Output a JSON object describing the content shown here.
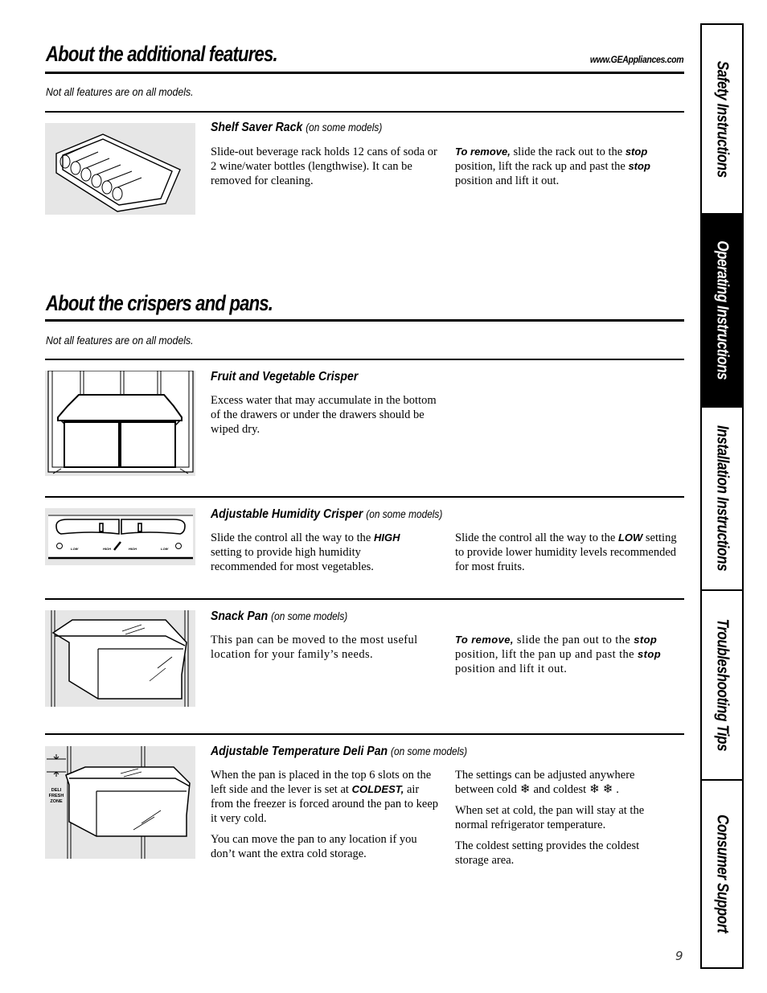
{
  "header": {
    "url": "www.GEAppliances.com"
  },
  "sections": [
    {
      "title": "About the additional features.",
      "note": "Not all features are on all models."
    },
    {
      "title": "About the crispers and pans.",
      "note": "Not all features are on all models."
    }
  ],
  "features": {
    "shelf_saver": {
      "title": "Shelf Saver Rack",
      "subtitle": "(on some models)",
      "col1": "Slide-out beverage rack holds 12 cans of soda or 2 wine/water bottles (lengthwise). It can be removed for cleaning.",
      "col2": {
        "lead": "To remove,",
        "t1": " slide the rack out to the ",
        "stop1": "stop",
        "t2": " position, lift the rack up and past the ",
        "stop2": "stop",
        "t3": " position and lift it out."
      }
    },
    "fruit_crisper": {
      "title": "Fruit and Vegetable Crisper",
      "col1": "Excess water that may accumulate in the bottom of the drawers or under the drawers should be wiped dry."
    },
    "humidity_crisper": {
      "title": "Adjustable Humidity Crisper",
      "subtitle": "(on some models)",
      "col1": {
        "t1": "Slide the control all the way to the ",
        "high": "HIGH",
        "t2": " setting to provide high humidity recommended for most vegetables."
      },
      "col2": {
        "t1": "Slide the control all the way to the ",
        "low": "LOW",
        "t2": " setting to provide lower humidity levels recommended for most fruits."
      },
      "diagram_labels": [
        "LOW",
        "HIGH",
        "HIGH",
        "LOW"
      ]
    },
    "snack_pan": {
      "title": "Snack Pan",
      "subtitle": "(on some models)",
      "col1": "This pan can be moved to the most useful location for your family’s needs.",
      "col2": {
        "lead": "To remove,",
        "t1": " slide the pan out to the ",
        "stop1": "stop",
        "t2": " position, lift the pan up and past the ",
        "stop2": "stop",
        "t3": " position and lift it out."
      }
    },
    "deli_pan": {
      "title": "Adjustable Temperature Deli Pan",
      "subtitle": "(on some models)",
      "col1_p1": {
        "t1": "When the pan is placed in the top 6 slots on the left side and the lever is set at ",
        "coldest": "COLDEST,",
        "t2": " air from the freezer is forced around the pan to keep it very cold."
      },
      "col1_p2": "You can move the pan to any location if you don’t want the extra cold storage.",
      "col2_p1": {
        "t1": "The settings can be adjusted anywhere between cold",
        "t2": "and coldest",
        "t3": "."
      },
      "col2_p2": "When set at cold, the pan will stay at the normal refrigerator temperature.",
      "col2_p3": "The coldest setting provides the coldest storage area.",
      "diagram_label": "DELI FRESH ZONE",
      "snowflake_glyph": "❄"
    }
  },
  "side_tabs": [
    {
      "label": "Safety Instructions",
      "active": false
    },
    {
      "label": "Operating Instructions",
      "active": true
    },
    {
      "label": "Installation Instructions",
      "active": false
    },
    {
      "label": "Troubleshooting Tips",
      "active": false
    },
    {
      "label": "Consumer Support",
      "active": false
    }
  ],
  "page_number": "9"
}
